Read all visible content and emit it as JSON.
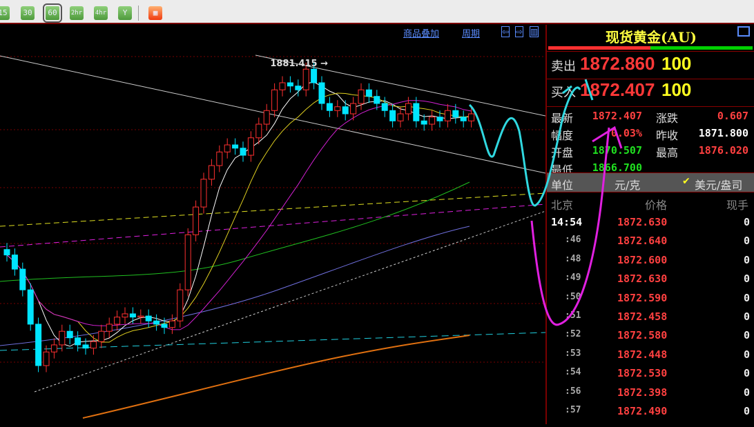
{
  "toolbar": {
    "periods": [
      "15",
      "30",
      "60",
      "2hr",
      "4hr",
      "Y"
    ],
    "selected": "60",
    "extra_icon": "grid-window-icon"
  },
  "chart_header": {
    "overlay_link": "商品叠加",
    "period_link": "周期"
  },
  "chart_data": {
    "type": "candlestick",
    "annotation_high": "1881.415",
    "closes": [
      1846.6,
      1844.0,
      1840.2,
      1833.9,
      1826.3,
      1828.8,
      1830.1,
      1832.6,
      1831.4,
      1830.1,
      1829.5,
      1830.7,
      1832.6,
      1833.9,
      1835.2,
      1835.8,
      1835.2,
      1835.4,
      1834.5,
      1833.9,
      1833.3,
      1834.5,
      1840.2,
      1850.3,
      1855.4,
      1860.5,
      1863.0,
      1865.5,
      1866.8,
      1866.2,
      1864.9,
      1868.1,
      1870.6,
      1873.1,
      1876.9,
      1878.2,
      1877.6,
      1876.9,
      1880.7,
      1878.2,
      1874.4,
      1873.1,
      1873.8,
      1872.5,
      1874.4,
      1876.9,
      1875.7,
      1874.4,
      1873.1,
      1871.2,
      1872.5,
      1874.4,
      1871.2,
      1870.6,
      1871.9,
      1871.2,
      1873.1,
      1871.9,
      1871.2,
      1872.5
    ],
    "colors": {
      "up": "#ff3030",
      "down": "#00e5ff",
      "ma5": "#ffffff",
      "ma10": "#e0d020",
      "ma20": "#d020d0",
      "ma60": "#20c020"
    }
  },
  "panel": {
    "title": "现货黄金(AU)",
    "sell": {
      "label": "卖出",
      "price": "1872.860",
      "qty": "100"
    },
    "buy": {
      "label": "买入",
      "price": "1872.407",
      "qty": "100"
    },
    "stats": [
      {
        "label": "最新",
        "value": "1872.407",
        "color": "#ff4040"
      },
      {
        "label": "涨跌",
        "value": "0.607",
        "color": "#ff4040"
      },
      {
        "label": "幅度",
        "value": "0.03%",
        "color": "#ff4040"
      },
      {
        "label": "昨收",
        "value": "1871.800",
        "color": "#ffffff"
      },
      {
        "label": "开盘",
        "value": "1870.507",
        "color": "#20e020"
      },
      {
        "label": "最高",
        "value": "1876.020",
        "color": "#ff4040"
      },
      {
        "label": "最低",
        "value": "1866.700",
        "color": "#20e020"
      }
    ],
    "unit": {
      "label": "单位",
      "option1": "元/克",
      "option2": "美元/盎司",
      "selected": "美元/盎司"
    },
    "ticks_header": {
      "time": "北京",
      "price": "价格",
      "vol": "现手"
    },
    "ticks": [
      {
        "time": "14:54",
        "price": "1872.630",
        "vol": "0"
      },
      {
        "time": ":46",
        "price": "1872.640",
        "vol": "0"
      },
      {
        "time": ":48",
        "price": "1872.600",
        "vol": "0"
      },
      {
        "time": ":49",
        "price": "1872.630",
        "vol": "0"
      },
      {
        "time": ":50",
        "price": "1872.590",
        "vol": "0"
      },
      {
        "time": ":51",
        "price": "1872.458",
        "vol": "0"
      },
      {
        "time": ":52",
        "price": "1872.580",
        "vol": "0"
      },
      {
        "time": ":53",
        "price": "1872.448",
        "vol": "0"
      },
      {
        "time": ":54",
        "price": "1872.530",
        "vol": "0"
      },
      {
        "time": ":56",
        "price": "1872.398",
        "vol": "0"
      },
      {
        "time": ":57",
        "price": "1872.490",
        "vol": "0"
      }
    ]
  }
}
